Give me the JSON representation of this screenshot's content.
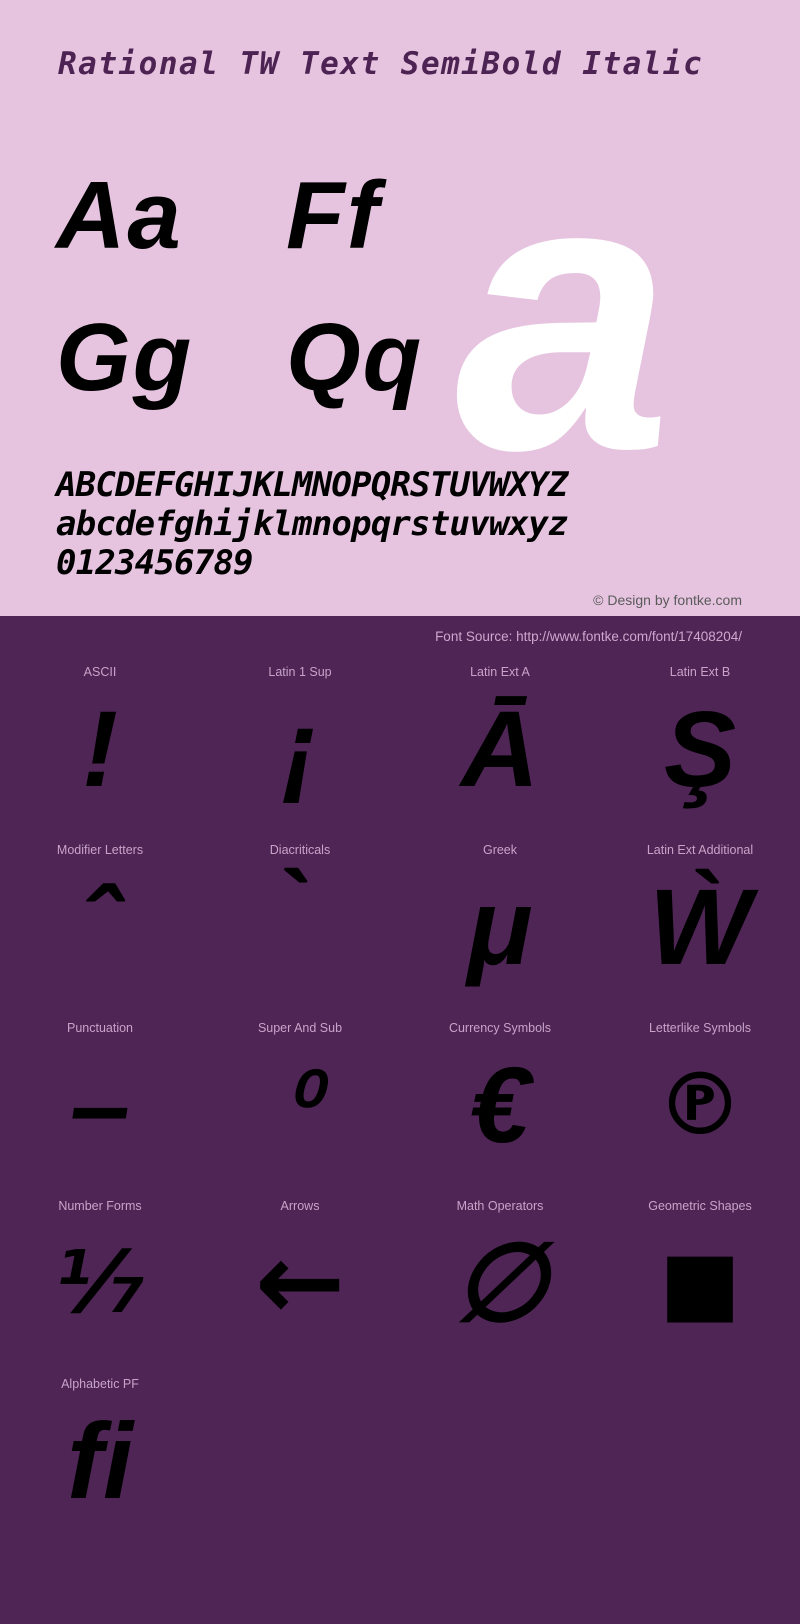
{
  "title": "Rational TW Text SemiBold Italic",
  "sample": {
    "pairs": [
      [
        "Aa",
        "Ff"
      ],
      [
        "Gg",
        "Qq"
      ]
    ],
    "big_letter": "a",
    "uppercase": "ABCDEFGHIJKLMNOPQRSTUVWXYZ",
    "lowercase": "abcdefghijklmnopqrstuvwxyz",
    "digits": "0123456789"
  },
  "credit": "© Design by fontke.com",
  "font_source": "Font Source: http://www.fontke.com/font/17408204/",
  "colors": {
    "top_background": "#e6c4e0",
    "bottom_background": "#4e2555",
    "title_text": "#4c2352",
    "glyph_black": "#000000",
    "glyph_white": "#ffffff",
    "label_text": "#c8a3c8",
    "credit_text": "#5a5a5a",
    "source_text": "#cfa7cd"
  },
  "unicode_blocks": [
    [
      {
        "label": "ASCII",
        "glyph": "!"
      },
      {
        "label": "Latin 1 Sup",
        "glyph": "¡"
      },
      {
        "label": "Latin Ext A",
        "glyph": "Ā"
      },
      {
        "label": "Latin Ext B",
        "glyph": "Ş"
      }
    ],
    [
      {
        "label": "Modifier Letters",
        "glyph": "ˆ"
      },
      {
        "label": "Diacriticals",
        "glyph": "̀"
      },
      {
        "label": "Greek",
        "glyph": "μ"
      },
      {
        "label": "Latin Ext Additional",
        "glyph": "Ẁ"
      }
    ],
    [
      {
        "label": "Punctuation",
        "glyph": "–"
      },
      {
        "label": "Super And Sub",
        "glyph": "⁰"
      },
      {
        "label": "Currency Symbols",
        "glyph": "€"
      },
      {
        "label": "Letterlike Symbols",
        "glyph": "℗"
      }
    ],
    [
      {
        "label": "Number Forms",
        "glyph": "⅐"
      },
      {
        "label": "Arrows",
        "glyph": "←"
      },
      {
        "label": "Math Operators",
        "glyph": "∅"
      },
      {
        "label": "Geometric Shapes",
        "glyph": "■"
      }
    ],
    [
      {
        "label": "Alphabetic PF",
        "glyph": "ﬁ"
      }
    ]
  ]
}
